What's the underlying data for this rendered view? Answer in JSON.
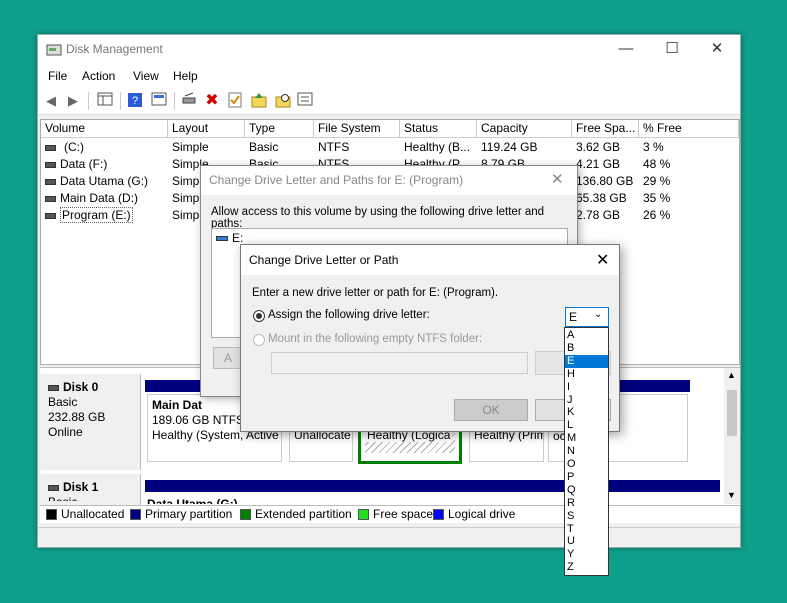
{
  "window": {
    "title": "Disk Management",
    "menu": [
      "File",
      "Action",
      "View",
      "Help"
    ]
  },
  "volume_table": {
    "columns": [
      "Volume",
      "Layout",
      "Type",
      "File System",
      "Status",
      "Capacity",
      "Free Spa...",
      "% Free"
    ],
    "rows": [
      [
        "(C:)",
        "Simple",
        "Basic",
        "NTFS",
        "Healthy (B...",
        "119.24 GB",
        "3.62 GB",
        "3 %"
      ],
      [
        "Data (F:)",
        "Simple",
        "Basic",
        "NTFS",
        "Healthy (P...",
        "8.79 GB",
        "4.21 GB",
        "48 %"
      ],
      [
        "Data Utama (G:)",
        "Simp",
        "",
        "",
        "",
        "",
        "136.80 GB",
        "29 %"
      ],
      [
        "Main Data (D:)",
        "Simp",
        "",
        "",
        "",
        "",
        "65.38 GB",
        "35 %"
      ],
      [
        "Program (E:)",
        "Simp",
        "",
        "",
        "",
        "",
        "2.78 GB",
        "26 %"
      ]
    ]
  },
  "disks": {
    "disk0": {
      "name": "Disk 0",
      "type": "Basic",
      "size": "232.88 GB",
      "state": "Online",
      "partitions": [
        {
          "title": "Main Dat",
          "detail": "189.06 GB NTFS",
          "status": "Healthy (System, Active"
        },
        {
          "title": "",
          "detail": "",
          "status": "Unallocate"
        },
        {
          "title": "",
          "detail": "",
          "status": "Healthy (Logica"
        },
        {
          "title": "",
          "detail": "",
          "status": "Healthy (Primary"
        },
        {
          "title": "",
          "detail": "3",
          "status": "ocated"
        }
      ]
    },
    "disk1": {
      "name": "Disk 1",
      "type": "Basic",
      "partition_title": "Data Utama (G:)"
    }
  },
  "legend": [
    {
      "label": "Unallocated",
      "color": "#000000"
    },
    {
      "label": "Primary partition",
      "color": "#00007f"
    },
    {
      "label": "Extended partition",
      "color": "#008000"
    },
    {
      "label": "Free space",
      "color": "#22dd22"
    },
    {
      "label": "Logical drive",
      "color": "#0000ff"
    }
  ],
  "dialog_paths": {
    "title": "Change Drive Letter and Paths for E: (Program)",
    "description": "Allow access to this volume by using the following drive letter and paths:",
    "entries": [
      "E:"
    ],
    "add_button": "A"
  },
  "dialog_letter": {
    "title": "Change Drive Letter or Path",
    "description": "Enter a new drive letter or path for E: (Program).",
    "assign_label": "Assign the following drive letter:",
    "mount_label": "Mount in the following empty NTFS folder:",
    "browse_button": "Bro",
    "ok_button": "OK",
    "cancel_button": "Ca",
    "selected_letter": "E",
    "letters": [
      "A",
      "B",
      "E",
      "H",
      "I",
      "J",
      "K",
      "L",
      "M",
      "N",
      "O",
      "P",
      "Q",
      "R",
      "S",
      "T",
      "U",
      "Y",
      "Z"
    ],
    "highlighted_letter": "E"
  }
}
